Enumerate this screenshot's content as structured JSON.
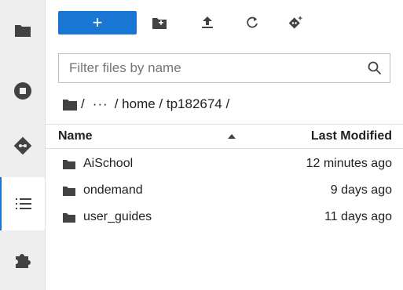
{
  "sidebar": {
    "items": [
      {
        "icon": "folder-icon"
      },
      {
        "icon": "stop-circle-icon"
      },
      {
        "icon": "git-icon"
      },
      {
        "icon": "list-icon"
      },
      {
        "icon": "extension-puzzle-icon"
      }
    ],
    "active_index": 3
  },
  "toolbar": {
    "new_label": "+",
    "icons": [
      "new-folder-icon",
      "upload-icon",
      "refresh-icon",
      "git-clone-icon"
    ]
  },
  "filter": {
    "placeholder": "Filter files by name",
    "value": ""
  },
  "breadcrumb": {
    "root": "/",
    "ellipsis": "···",
    "path": "/ home / tp182674 /"
  },
  "file_list": {
    "columns": {
      "name": "Name",
      "modified": "Last Modified"
    },
    "rows": [
      {
        "name": "AiSchool",
        "modified": "12 minutes ago"
      },
      {
        "name": "ondemand",
        "modified": "9 days ago"
      },
      {
        "name": "user_guides",
        "modified": "11 days ago"
      }
    ]
  },
  "colors": {
    "accent": "#1976d2",
    "icon": "#424242",
    "sidebar_bg": "#eeeeee"
  }
}
